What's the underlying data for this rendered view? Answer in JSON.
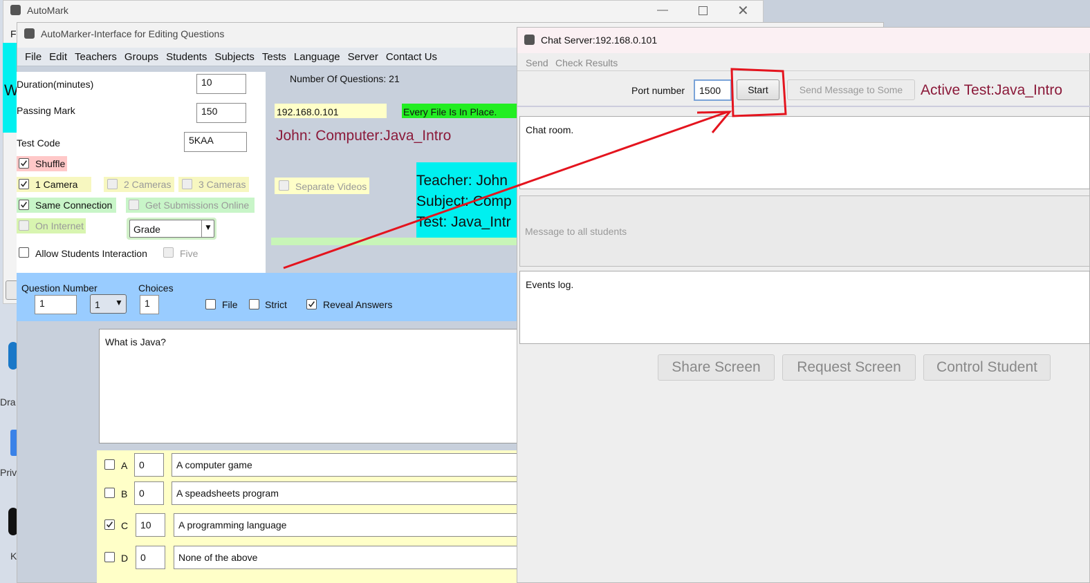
{
  "outer": {
    "title": "AutoMark",
    "menu_f": "F",
    "side_w": "W"
  },
  "editor": {
    "title": "AutoMarker-Interface for Editing Questions",
    "menu": [
      "File",
      "Edit",
      "Teachers",
      "Groups",
      "Students",
      "Subjects",
      "Tests",
      "Language",
      "Server",
      "Contact Us"
    ],
    "duration_label": "Duration(minutes)",
    "duration_value": "10",
    "passing_label": "Passing Mark",
    "passing_value": "150",
    "testcode_label": "Test Code",
    "testcode_value": "5KAA",
    "shuffle": "Shuffle",
    "camera1": "1 Camera",
    "camera2": "2 Cameras",
    "camera3": "3 Cameras",
    "same_conn": "Same Connection",
    "get_subs": "Get Submissions Online",
    "on_internet": "On Internet",
    "grade_select": "Grade",
    "allow_interaction": "Allow Students Interaction",
    "five": "Five",
    "num_questions": "Number Of Questions: 21",
    "ip": "192.168.0.101",
    "files_status": "Every File Is In Place.",
    "active_line": "John: Computer:Java_Intro",
    "separate_videos": "Separate Videos",
    "teacher_info": [
      "Teacher: John",
      "Subject: Comp",
      "Test: Java_Intr"
    ],
    "question_number_label": "Question Number",
    "question_number_value": "1",
    "question_select": "1",
    "choices_label": "Choices",
    "choices_value": "1",
    "file_label": "File",
    "strict_label": "Strict",
    "reveal_label": "Reveal Answers",
    "question_text": "What is Java?",
    "answers": [
      {
        "letter": "A",
        "score": "0",
        "text": "A computer game",
        "checked": false
      },
      {
        "letter": "B",
        "score": "0",
        "text": "A speadsheets program",
        "checked": false
      },
      {
        "letter": "C",
        "score": "10",
        "text": "A programming language",
        "checked": true
      },
      {
        "letter": "D",
        "score": "0",
        "text": "None of the above",
        "checked": false
      }
    ]
  },
  "chat": {
    "title": "Chat Server:192.168.0.101",
    "menu": [
      "Send",
      "Check Results"
    ],
    "port_label": "Port number",
    "port_value": "1500",
    "start_button": "Start",
    "send_some_button": "Send Message to Some",
    "active_test": "Active Test:Java_Intro",
    "chat_room": "Chat room.",
    "message_placeholder": "Message to all students",
    "events_log": "Events log.",
    "share_screen": "Share Screen",
    "request_screen": "Request Screen",
    "control_student": "Control Student"
  },
  "desktop": {
    "dra": "Dra",
    "priv": "Priv",
    "k": "K"
  },
  "colors": {
    "annotation": "#e4141e",
    "accent_text": "#8b1a3a",
    "cyan": "#00f0f0",
    "question_bar": "#99ccff"
  }
}
